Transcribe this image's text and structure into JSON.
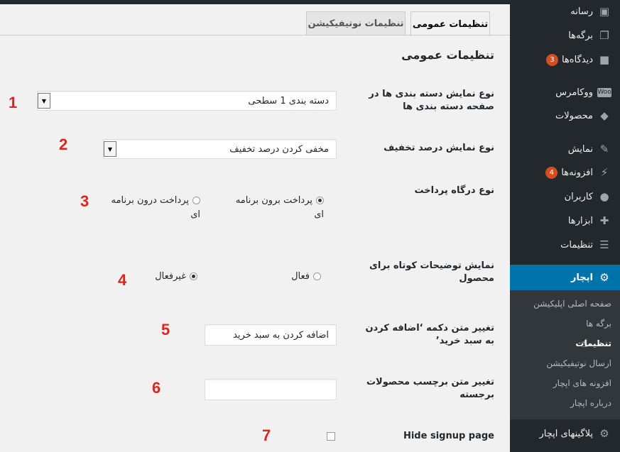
{
  "sidebar": {
    "items": [
      {
        "label": "رسانه",
        "icon": "media-icon"
      },
      {
        "label": "برگه‌ها",
        "icon": "pages-icon"
      },
      {
        "label": "دیدگاه‌ها",
        "icon": "comments-icon",
        "badge": "3"
      },
      {
        "label": "ووکامرس",
        "icon": "woocommerce-icon"
      },
      {
        "label": "محصولات",
        "icon": "products-icon"
      },
      {
        "label": "نمایش",
        "icon": "appearance-icon"
      },
      {
        "label": "افزونه‌ها",
        "icon": "plugins-icon",
        "badge": "4"
      },
      {
        "label": "کاربران",
        "icon": "users-icon"
      },
      {
        "label": "ابزارها",
        "icon": "tools-icon"
      },
      {
        "label": "تنظیمات",
        "icon": "settings-icon"
      },
      {
        "label": "اپچار",
        "icon": "gear-icon",
        "active": true
      },
      {
        "label": "پلاگینهای اپچار",
        "icon": "gear-icon"
      }
    ],
    "submenu": [
      {
        "label": "صفحه اصلی اپلیکیشن"
      },
      {
        "label": "برگه ها"
      },
      {
        "label": "تنظیمات",
        "current": true
      },
      {
        "label": "ارسال نوتیفیکیشن"
      },
      {
        "label": "افزونه های اپچار"
      },
      {
        "label": "درباره اپچار"
      }
    ]
  },
  "tabs": [
    {
      "label": "تنظیمات عمومی",
      "active": true
    },
    {
      "label": "تنظیمات نوتیفیکیشن",
      "active": false
    }
  ],
  "page_title": "تنظیمات عمومی",
  "fields": {
    "category_display": {
      "label": "نوع نمایش دسته بندی ها در صفحه دسته بندی ها",
      "value": "دسته بندی 1 سطحی"
    },
    "discount_display": {
      "label": "نوع نمایش درصد تخفیف",
      "value": "مخفی کردن درصد تخفیف"
    },
    "payment_gateway": {
      "label": "نوع درگاه پرداخت",
      "options": [
        "پرداخت برون برنامه ای",
        "پرداخت درون برنامه ای"
      ],
      "selected": "پرداخت برون برنامه ای"
    },
    "short_description": {
      "label": "نمایش توضیحات کوتاه برای محصول",
      "options": [
        "فعال",
        "غیرفعال"
      ],
      "selected": "غیرفعال"
    },
    "add_to_cart_text": {
      "label": "تغییر متن دکمه ‘اضافه کردن به سبد خرید’",
      "value": "اضافه کردن به سبد خرید"
    },
    "featured_label_text": {
      "label": "تغییر متن برچسب محصولات برجسته",
      "value": ""
    },
    "hide_signup": {
      "label": "Hide signup page",
      "checked": false
    }
  },
  "annotations": [
    "1",
    "2",
    "3",
    "4",
    "5",
    "6",
    "7"
  ],
  "colors": {
    "sidebar_bg": "#23282d",
    "active_blue": "#0073aa",
    "badge_orange": "#d54e21",
    "annotation_red": "#e3231c"
  }
}
